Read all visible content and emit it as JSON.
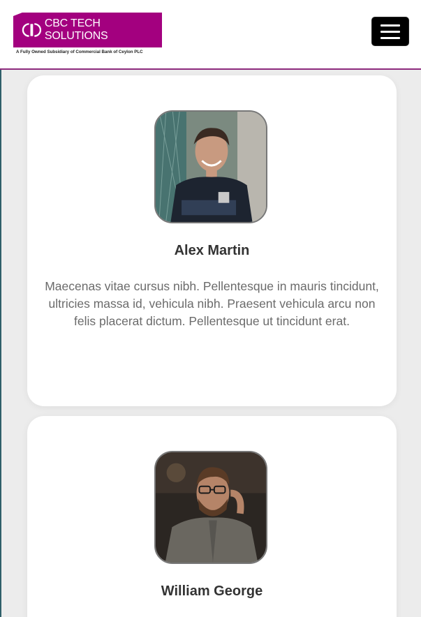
{
  "header": {
    "brand": "CBC TECH SOLUTIONS",
    "tagline": "A Fully Owned Subsidiary of Commercial Bank of Ceylon PLC",
    "brand_color": "#a3007f",
    "menu_icon": "hamburger-menu-icon"
  },
  "team": [
    {
      "name": "Alex Martin",
      "bio": "Maecenas vitae cursus nibh. Pellentesque in mauris tincidunt, ultricies massa id, vehicula nibh. Praesent vehicula arcu non felis placerat dictum. Pellentesque ut tincidunt erat."
    },
    {
      "name": "William George"
    }
  ]
}
